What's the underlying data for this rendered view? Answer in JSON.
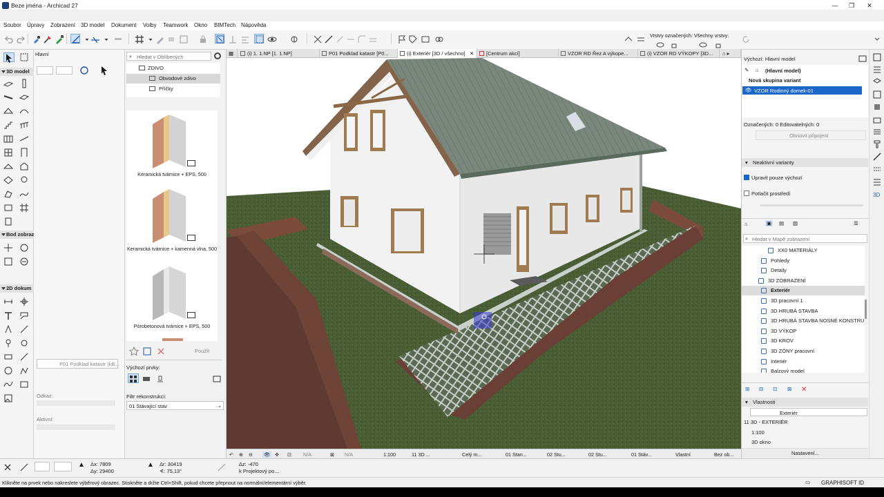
{
  "window": {
    "title": "Beze jména - Archicad 27"
  },
  "menu": [
    "Soubor",
    "Úpravy",
    "Zobrazení",
    "3D model",
    "Dokument",
    "Volby",
    "Teamwork",
    "Okno",
    "BIMTech",
    "Nápověda"
  ],
  "toolbar": {
    "layers_marked": "Vrstvy označených:",
    "all_layers": "Všechny vrstvy:"
  },
  "toolbox": {
    "label_main": "Hlavní",
    "section_3d": "3D model",
    "section_points": "Bod zobraz",
    "section_2d": "2D dokum"
  },
  "info_box": {
    "ref_label": "P01 Podklad katastr (kB...",
    "odkaz_label": "Odkaz:",
    "aktivni_label": "Aktivní:"
  },
  "favorites": {
    "search_placeholder": "Hledat v Oblíbených",
    "tree": [
      {
        "label": "ZDIVO"
      },
      {
        "label": "Obvodové zdivo",
        "selected": true
      },
      {
        "label": "Příčky"
      }
    ],
    "items": [
      {
        "label": "Keramická tvárnice + EPS, 500"
      },
      {
        "label": "Keramická tvárnice + kamenná vlna, 500"
      },
      {
        "label": "Pórobetonová tvárnice + EPS, 500"
      }
    ],
    "use_button": "Použít",
    "default_elements_label": "Výchozí prvky:",
    "reconstruction_filter_label": "Filtr rekonstrukcí:",
    "reconstruction_filter_value": "01 Stávající stav"
  },
  "tabs": [
    {
      "label": "(i) 1. 1.NP [1. 1.NP]"
    },
    {
      "label": "P01 Podklad katastr [P0..."
    },
    {
      "label": "(i) Exteriér [3D / všechno]",
      "active": true
    },
    {
      "label": "[Centrum akcí]"
    },
    {
      "label": "VZOR RD Řez A výkope..."
    },
    {
      "label": "(i) VZOR RD VÝKOPY [3D..."
    }
  ],
  "view_status": {
    "na1": "N/A",
    "na2": "N/A",
    "scale": "1:100",
    "view_name": "11 3D ...",
    "model": "Celý m...",
    "stage": "01 Stan...",
    "structure1": "02 Stu...",
    "structure2": "02 Stu...",
    "state": "01 Stáv...",
    "mode": "Vlastní",
    "no_override": "Bez ob..."
  },
  "variants": {
    "header": "Výchozí: Hlavní model",
    "main_model": "(Hlavní model)",
    "new_group": "Nová skupina variant",
    "selected_variant": "VZOR Rodinný domek-01",
    "marked": "Označených: 0 Editovatelných: 0",
    "refresh": "Obnovit připojení",
    "inactive_header": "Neaktivní varianty",
    "edit_default_only": "Upravit pouze výchozí",
    "suppress_env": "Potlačit prostředí"
  },
  "navigator": {
    "search_placeholder": "Hledat v Mapě zobrazení",
    "items": [
      {
        "label": "XX0 MATERIÁLY",
        "indent": 3
      },
      {
        "label": "Pohledy",
        "indent": 2
      },
      {
        "label": "Detaily",
        "indent": 2
      },
      {
        "label": "3D ZOBRAZENÍ",
        "indent": 1
      },
      {
        "label": "Exteriér",
        "indent": 2,
        "selected": true
      },
      {
        "label": "3D pracovní 1",
        "indent": 2
      },
      {
        "label": "3D HRUBÁ STAVBA",
        "indent": 2
      },
      {
        "label": "3D HRUBÁ STAVBA NOSNÉ KONSTRUKCE",
        "indent": 2
      },
      {
        "label": "3D VÝKOP",
        "indent": 2
      },
      {
        "label": "3D KROV",
        "indent": 2
      },
      {
        "label": "3D ZÓNY pracovní",
        "indent": 2
      },
      {
        "label": "Interiér",
        "indent": 2
      },
      {
        "label": "Balzový model",
        "indent": 2
      }
    ]
  },
  "properties": {
    "header": "Vlastnosti",
    "name": "Exteriér",
    "view_id": "11 3D - EXTERIÉR",
    "scale": "1:100",
    "window": "3D okno",
    "settings_button": "Nastavení..."
  },
  "coords": {
    "dx": "Δx: 7809",
    "dy": "Δy: 29400",
    "ar": "Δr: 30419",
    "aa": "∢: 75,13°",
    "az": "Δz: -470",
    "ref": "k Projektový po..."
  },
  "message": "Klikněte na prvek nebo nakreslete výběrový obrazec. Stiskněte a držte Ctrl+Shift, pokud chcete přepnout na normální/elementární výběr.",
  "brand": "GRAPHISOFT ID",
  "colors": {
    "accent": "#1a66c9",
    "roof": "#78857a",
    "grass": "#475a33",
    "wall": "#f2f2f2"
  }
}
